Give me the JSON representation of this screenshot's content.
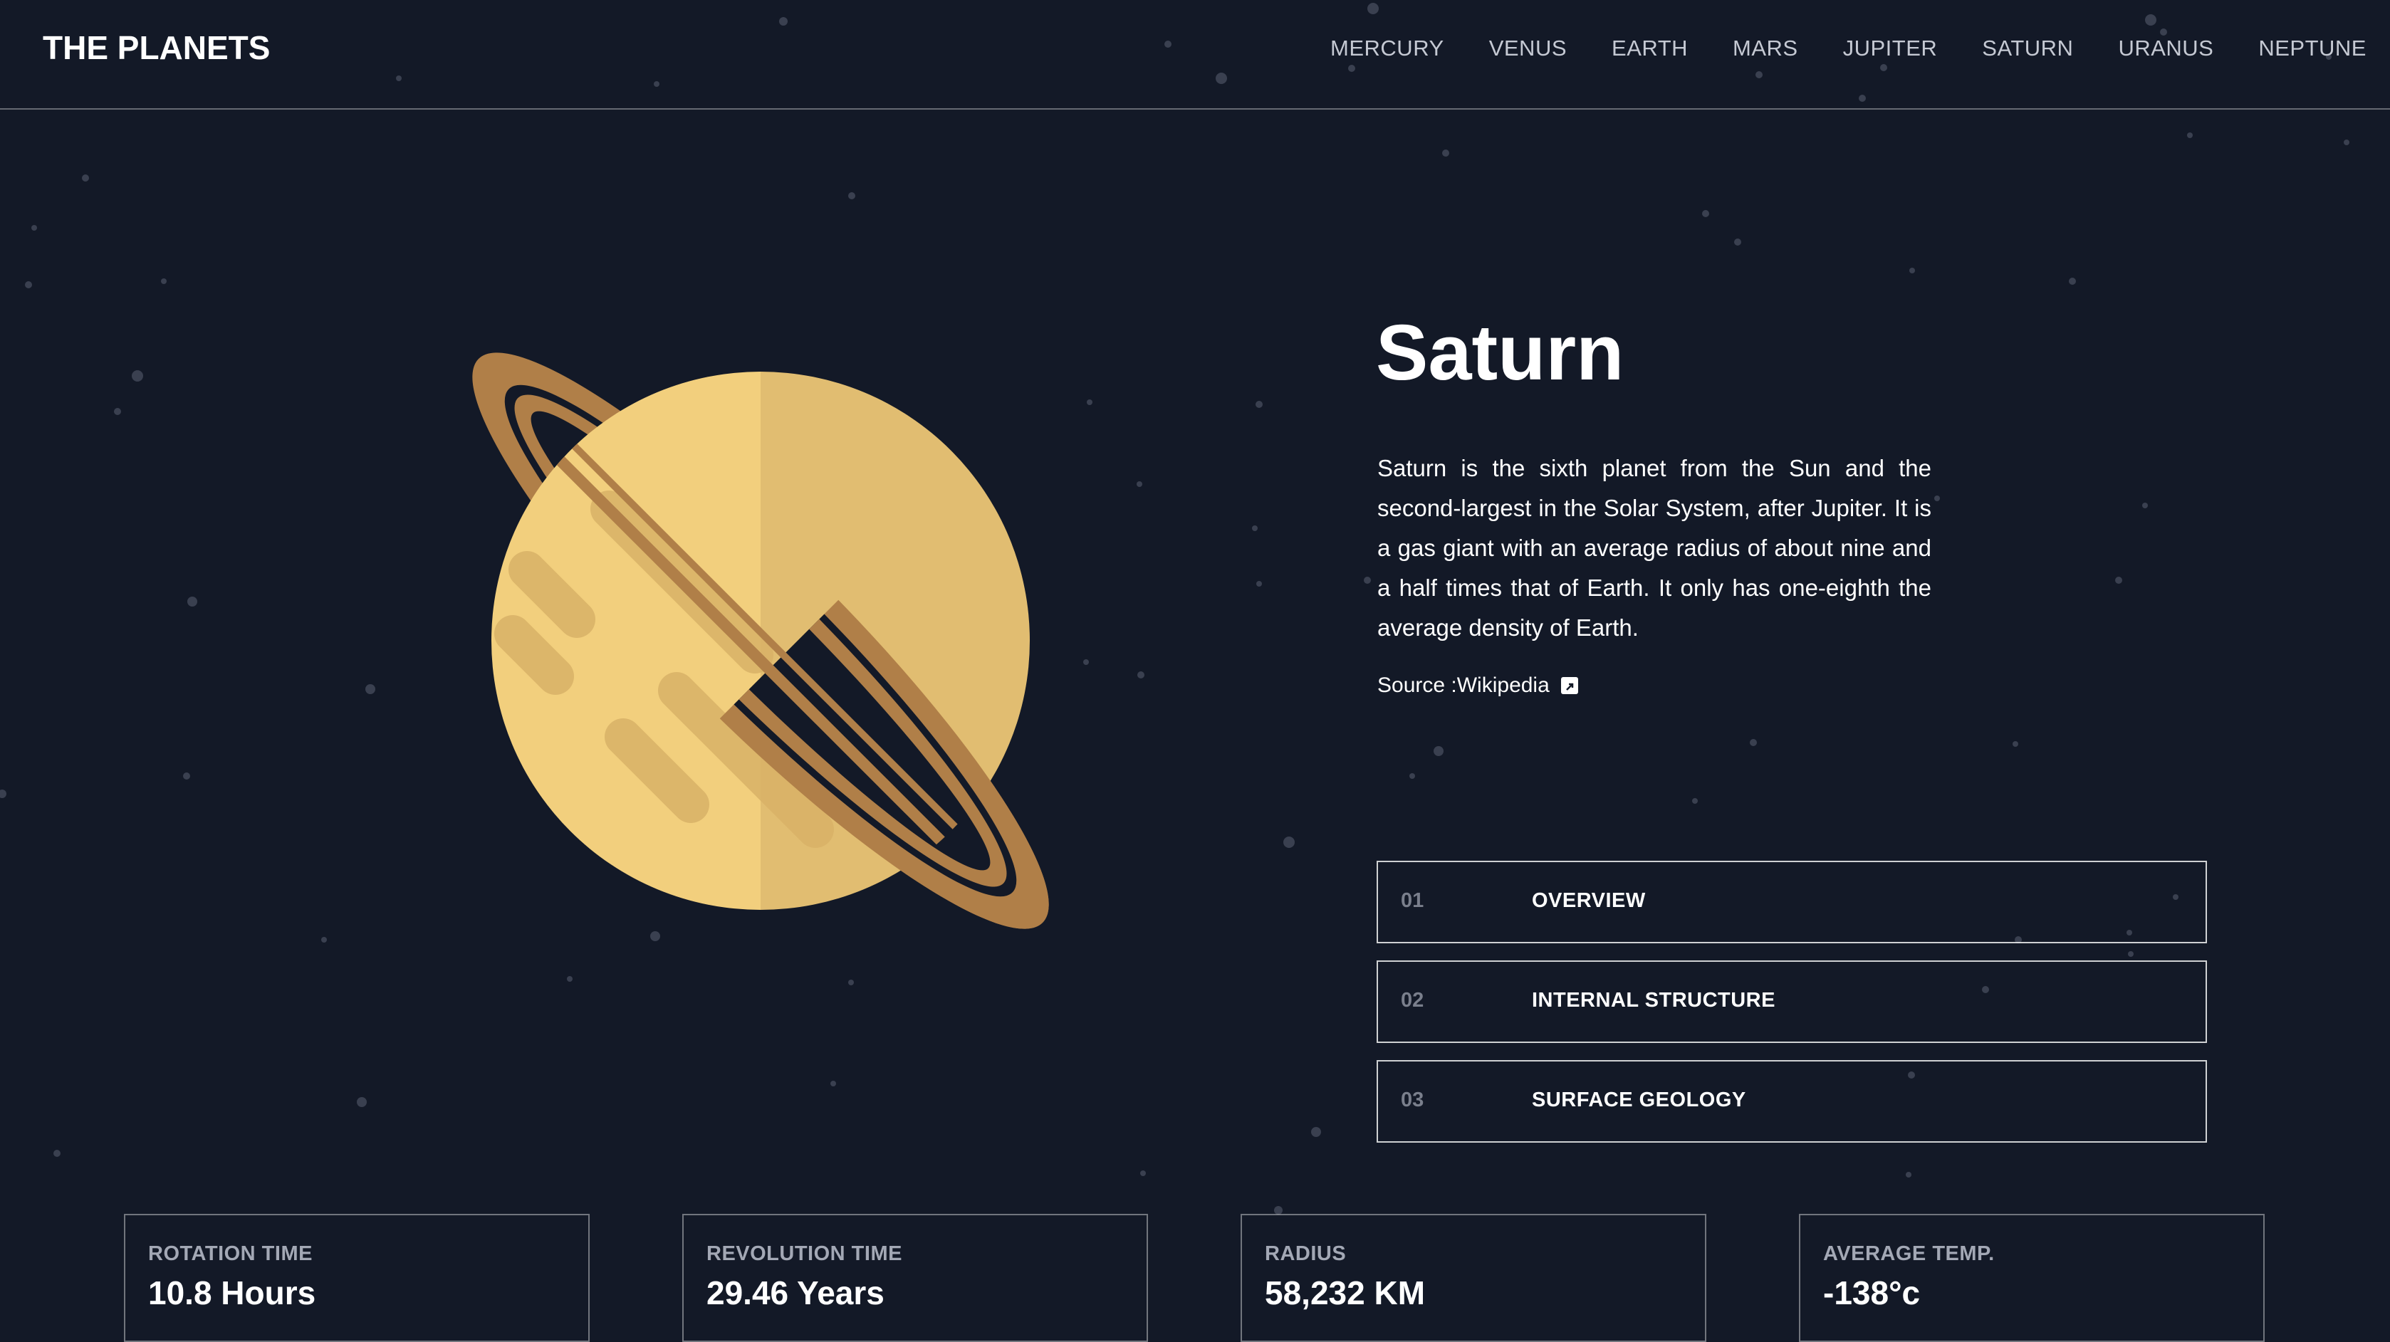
{
  "header": {
    "logo": "THE PLANETS",
    "nav": [
      "MERCURY",
      "VENUS",
      "EARTH",
      "MARS",
      "JUPITER",
      "SATURN",
      "URANUS",
      "NEPTUNE"
    ]
  },
  "planet": {
    "name": "Saturn",
    "description": "Saturn is the sixth planet from the Sun and the second-largest in the Solar System, after Jupiter. It is a gas giant with an average radius of about nine and a half times that of Earth. It only has one-eighth the average density of Earth.",
    "source_label": "Source :",
    "source_link": "Wikipedia",
    "source_icon": "external-link-icon"
  },
  "tabs": [
    {
      "num": "01",
      "label": "OVERVIEW"
    },
    {
      "num": "02",
      "label": "INTERNAL STRUCTURE"
    },
    {
      "num": "03",
      "label": "SURFACE GEOLOGY"
    }
  ],
  "stats": [
    {
      "label": "ROTATION TIME",
      "value": "10.8 Hours"
    },
    {
      "label": "REVOLUTION TIME",
      "value": "29.46 Years"
    },
    {
      "label": "RADIUS",
      "value": "58,232 KM"
    },
    {
      "label": "AVERAGE TEMP.",
      "value": "-138°c"
    }
  ],
  "colors": {
    "background": "#131927",
    "planet_light": "#F2CF7D",
    "planet_dark": "#E1BD71",
    "ring": "#B07F48"
  }
}
